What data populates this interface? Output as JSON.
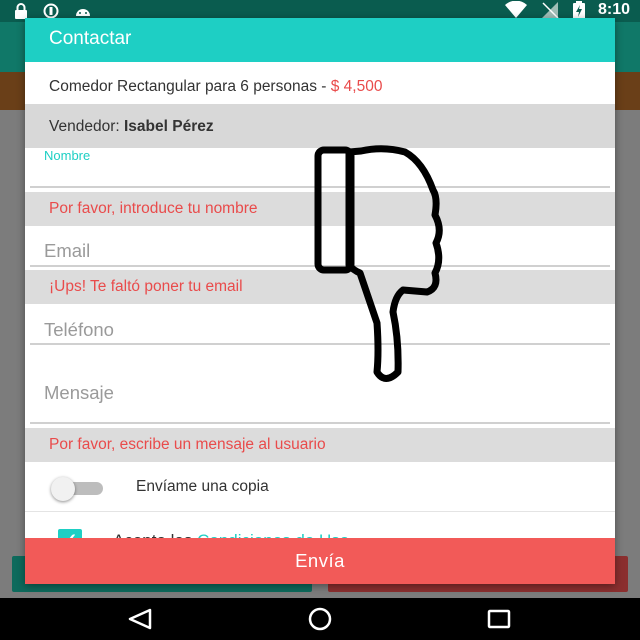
{
  "status_bar": {
    "time": "8:10",
    "left_icons": [
      "lock-icon",
      "circle-icon",
      "android-icon"
    ],
    "right_icons": [
      "wifi-icon",
      "signal-icon",
      "battery-icon"
    ]
  },
  "dialog": {
    "title": "Contactar",
    "product": {
      "name": "Comedor Rectangular para 6 personas - ",
      "price": "$ 4,500"
    },
    "seller": {
      "label": "Vendedor: ",
      "name": "Isabel Pérez"
    },
    "fields": {
      "name": {
        "label": "Nombre",
        "value": "",
        "error": "Por favor, introduce tu nombre"
      },
      "email": {
        "placeholder": "Email",
        "error": "¡Ups! Te faltó poner tu email"
      },
      "phone": {
        "placeholder": "Teléfono"
      },
      "message": {
        "placeholder": "Mensaje",
        "error": "Por favor, escribe un mensaje al usuario"
      }
    },
    "copy_toggle": {
      "label": "Envíame una copia",
      "checked": false
    },
    "terms": {
      "text": "Acepto los ",
      "link": "Condiciones de Uso",
      "checked": true
    },
    "send_button": "Envía"
  },
  "navbar": {
    "icons": [
      "back-icon",
      "home-icon",
      "recents-icon"
    ]
  },
  "colors": {
    "accent": "#1ecfc4",
    "error": "#e94b4b",
    "send": "#f25a58"
  }
}
